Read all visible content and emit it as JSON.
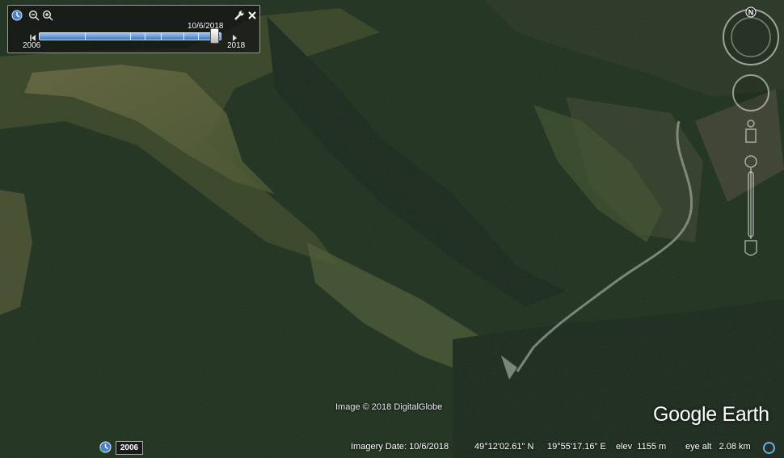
{
  "app": "Google Earth",
  "history_panel": {
    "start_year": "2006",
    "end_year": "2018",
    "selected_date": "10/6/2018",
    "slider_position": 0.97
  },
  "controls": {
    "north_label": "N",
    "clock_icon": "clock-icon",
    "zoom_out_icon": "zoom-out-icon",
    "zoom_in_icon": "zoom-in-icon",
    "settings_icon": "wrench-icon",
    "close_icon": "close-icon"
  },
  "map": {
    "attribution": "Image © 2018 DigitalGlobe",
    "logo": "Google Earth"
  },
  "status_bar": {
    "history_year": "2006",
    "imagery_date": "Imagery Date: 10/6/2018",
    "latitude": "49°12'02.61\" N",
    "longitude": "19°55'17.16\" E",
    "elevation": "elev  1155 m",
    "eye_altitude": "eye alt   2.08 km"
  },
  "colors": {
    "forest_dark": "#1a2a1a",
    "slider_blue": "#3e77c4",
    "stream_blue": "#6ab0e8"
  }
}
